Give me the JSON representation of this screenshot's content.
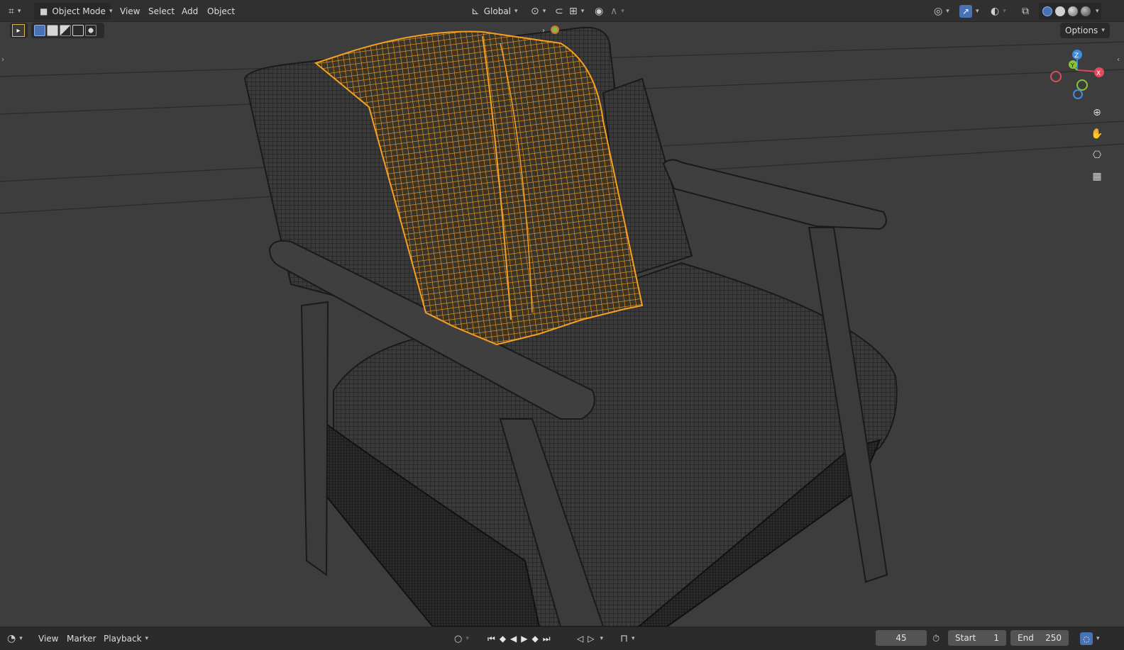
{
  "header": {
    "mode_label": "Object Mode",
    "menus": [
      "View",
      "Select",
      "Add",
      "Object"
    ],
    "orientation_label": "Global",
    "options_label": "Options"
  },
  "icons": {
    "editor_type": "editor-type-icon",
    "mode": "object-mode-icon",
    "orientation": "transform-orientation-icon",
    "pivot": "pivot-point-icon",
    "snap": "snap-magnet-icon",
    "snap_target": "snap-increment-icon",
    "proportional": "proportional-editing-icon",
    "falloff": "falloff-curve-icon",
    "visibility": "eye-visibility-icon",
    "gizmo": "gizmo-icon",
    "overlay": "overlay-icon",
    "xray": "xray-icon",
    "zoom": "zoom-icon",
    "pan": "hand-pan-icon",
    "camera": "camera-view-icon",
    "ortho": "grid-ortho-icon",
    "clock": "clock-icon"
  },
  "gizmo": {
    "z": "Z",
    "y": "Y",
    "x": "X"
  },
  "timeline": {
    "menus": [
      "View",
      "Marker",
      "Playback"
    ],
    "current_frame": "45",
    "start_label": "Start",
    "start_value": "1",
    "end_label": "End",
    "end_value": "250"
  },
  "colors": {
    "accent_blue": "#4772b3",
    "selected_orange": "#f5a023",
    "axis_x": "#e04a5c",
    "axis_y": "#8bc23a",
    "axis_z": "#3d8ee0"
  }
}
